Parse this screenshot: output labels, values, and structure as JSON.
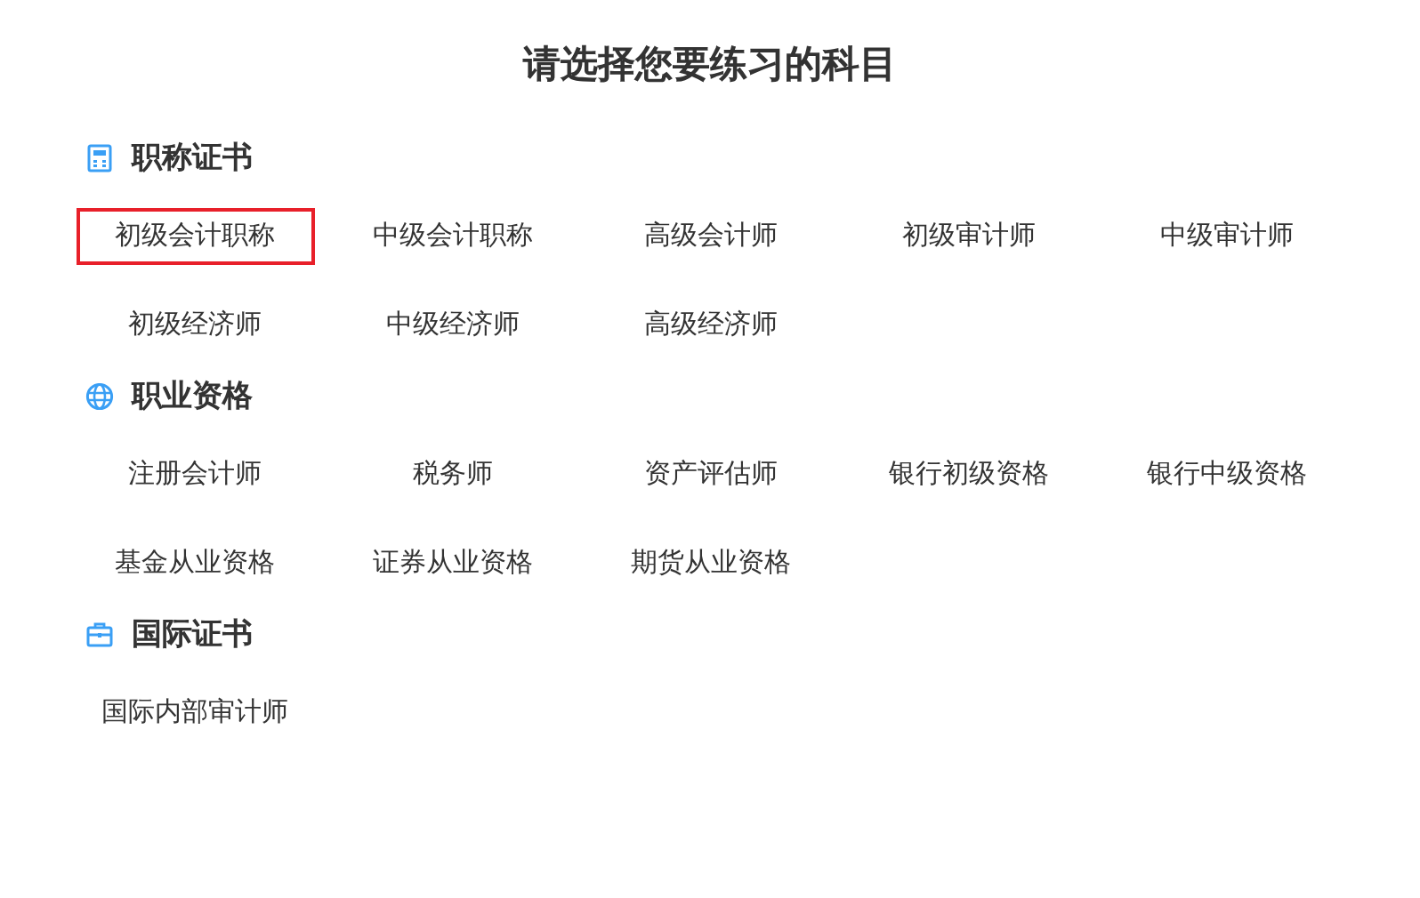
{
  "title": "请选择您要练习的科目",
  "sections": [
    {
      "kind": "calculator",
      "name": "职称证书",
      "items": [
        {
          "label": "初级会计职称",
          "selected": true
        },
        {
          "label": "中级会计职称",
          "selected": false
        },
        {
          "label": "高级会计师",
          "selected": false
        },
        {
          "label": "初级审计师",
          "selected": false
        },
        {
          "label": "中级审计师",
          "selected": false
        },
        {
          "label": "初级经济师",
          "selected": false
        },
        {
          "label": "中级经济师",
          "selected": false
        },
        {
          "label": "高级经济师",
          "selected": false
        }
      ]
    },
    {
      "kind": "globe",
      "name": "职业资格",
      "items": [
        {
          "label": "注册会计师",
          "selected": false
        },
        {
          "label": "税务师",
          "selected": false
        },
        {
          "label": "资产评估师",
          "selected": false
        },
        {
          "label": "银行初级资格",
          "selected": false
        },
        {
          "label": "银行中级资格",
          "selected": false
        },
        {
          "label": "基金从业资格",
          "selected": false
        },
        {
          "label": "证券从业资格",
          "selected": false
        },
        {
          "label": "期货从业资格",
          "selected": false
        }
      ]
    },
    {
      "kind": "briefcase",
      "name": "国际证书",
      "items": [
        {
          "label": "国际内部审计师",
          "selected": false
        }
      ]
    }
  ]
}
